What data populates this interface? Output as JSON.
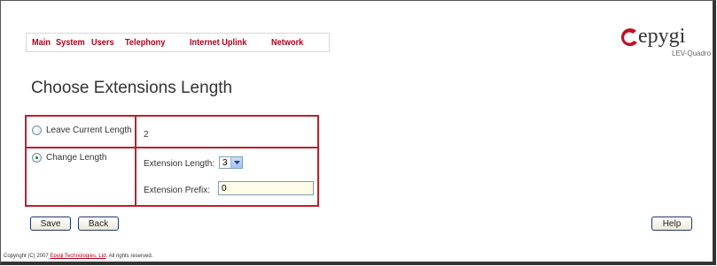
{
  "nav": {
    "items": [
      "Main",
      "System",
      "Users",
      "Telephony",
      "Internet Uplink",
      "Network"
    ]
  },
  "logo": {
    "brand": "epygi",
    "model": "LEV-Quadro",
    "icon": "epygi-logo-icon"
  },
  "page": {
    "title": "Choose Extensions Length"
  },
  "options": {
    "leave_current": {
      "label": "Leave Current Length",
      "value": "2",
      "selected": false
    },
    "change": {
      "label": "Change Length",
      "selected": true,
      "extension_length_label": "Extension Length:",
      "extension_length_value": "3",
      "extension_prefix_label": "Extension Prefix:",
      "extension_prefix_value": "0"
    }
  },
  "buttons": {
    "save": "Save",
    "back": "Back",
    "help": "Help"
  },
  "footer": {
    "prefix": "Copyright (C) 2007 ",
    "company": "Epygi Technologies, Ltd",
    "suffix": ". All rights reserved."
  },
  "colors": {
    "accent": "#b3001b",
    "table_border": "#c0202a"
  }
}
